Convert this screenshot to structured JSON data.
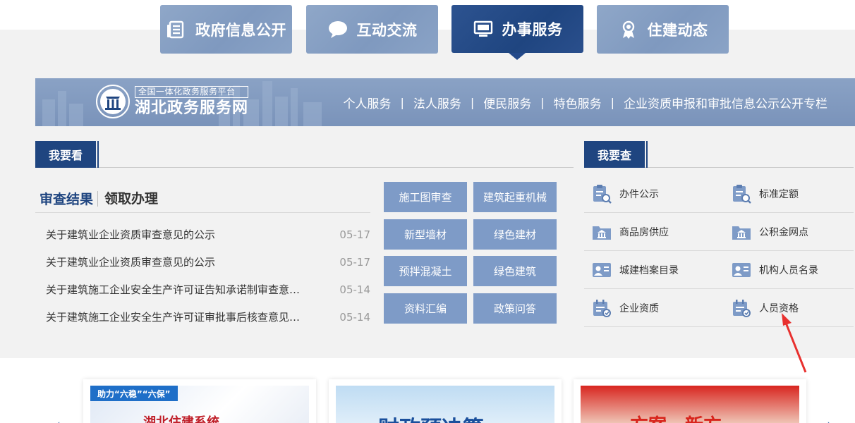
{
  "tabs": [
    {
      "label": "政府信息公开",
      "icon": "document-icon",
      "active": false
    },
    {
      "label": "互动交流",
      "icon": "chat-bubble-icon",
      "active": false
    },
    {
      "label": "办事服务",
      "icon": "monitor-icon",
      "active": true
    },
    {
      "label": "住建动态",
      "icon": "award-ribbon-icon",
      "active": false
    }
  ],
  "banner": {
    "logo_subtitle": "全国一体化政务服务平台",
    "logo_title": "湖北政务服务网",
    "nav": [
      "个人服务",
      "法人服务",
      "便民服务",
      "特色服务",
      "企业资质申报和审批信息公示公开专栏"
    ],
    "separator": "|"
  },
  "watch": {
    "title": "我要看",
    "subtabs": [
      "审查结果",
      "领取办理"
    ],
    "news": [
      {
        "title": "关于建筑业企业资质审查意见的公示",
        "date": "05-17"
      },
      {
        "title": "关于建筑业企业资质审查意见的公示",
        "date": "05-17"
      },
      {
        "title": "关于建筑施工企业安全生产许可证告知承诺制审查意见的公示",
        "date": "05-14"
      },
      {
        "title": "关于建筑施工企业安全生产许可证审批事后核查意见的公示",
        "date": "05-14"
      }
    ],
    "buttons": [
      "施工图审查",
      "建筑起重机械",
      "新型墙材",
      "绿色建材",
      "预拌混凝土",
      "绿色建筑",
      "资料汇编",
      "政策问答"
    ]
  },
  "query": {
    "title": "我要查",
    "items": [
      {
        "label": "办件公示",
        "icon": "clipboard-search-icon"
      },
      {
        "label": "标准定额",
        "icon": "clipboard-search-icon"
      },
      {
        "label": "商品房供应",
        "icon": "folder-bank-icon"
      },
      {
        "label": "公积金网点",
        "icon": "folder-bank-icon"
      },
      {
        "label": "城建档案目录",
        "icon": "person-card-icon"
      },
      {
        "label": "机构人员名录",
        "icon": "person-card-icon"
      },
      {
        "label": "企业资质",
        "icon": "calendar-check-icon"
      },
      {
        "label": "人员资格",
        "icon": "calendar-check-icon"
      }
    ]
  },
  "cards": [
    {
      "badge": "助力“六稳”“六保”",
      "caption": "湖北住建系统"
    },
    {
      "caption": "财政预决算"
    },
    {
      "caption": "方案…新方"
    }
  ],
  "colors": {
    "primary": "#1f4580",
    "tab_inactive": "#8aa3c6",
    "button": "#7e9bc7",
    "arrow": "#e8302e"
  }
}
